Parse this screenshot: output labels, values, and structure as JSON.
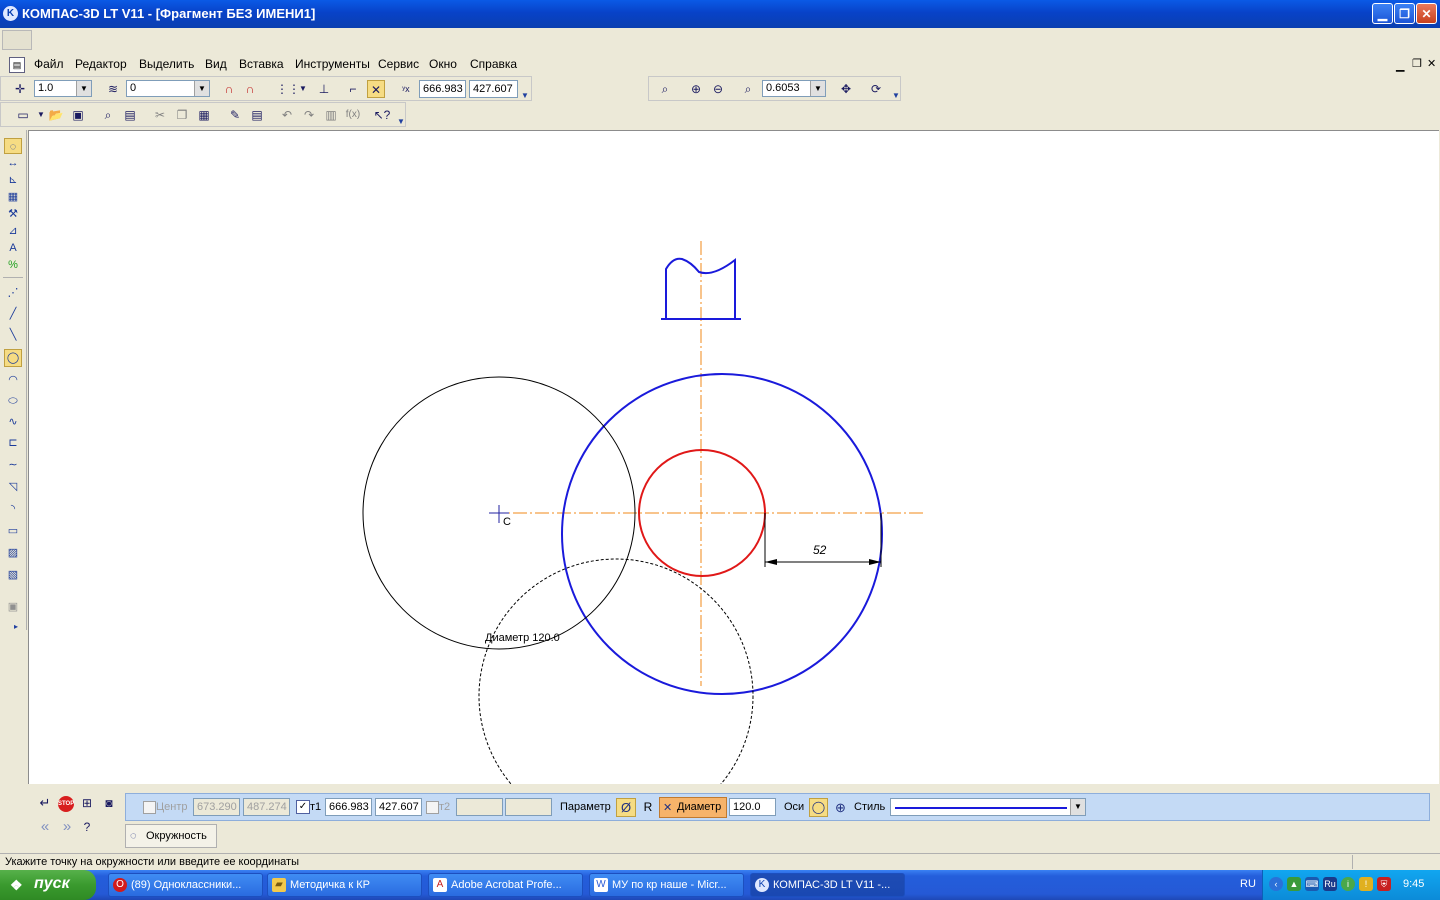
{
  "window": {
    "title": "КОМПАС-3D LT V11 - [Фрагмент БЕЗ ИМЕНИ1]",
    "app_icon": "kompas-icon",
    "controls": [
      "minimize-icon",
      "restore-icon",
      "close-icon"
    ]
  },
  "menu": {
    "items": [
      "Файл",
      "Редактор",
      "Выделить",
      "Вид",
      "Вставка",
      "Инструменты",
      "Сервис",
      "Окно",
      "Справка"
    ]
  },
  "toolbar_current": {
    "step_value": "1.0",
    "layer_value": "0",
    "coord_x": "666.983",
    "coord_y": "427.607"
  },
  "toolbar_view": {
    "zoom_value": "0.6053"
  },
  "canvas": {
    "dimension_text": "52",
    "phantom_label": "Диаметр 120.0",
    "cursor_label": "C",
    "colors": {
      "blue": "#1a1adb",
      "red": "#e01818",
      "axis": "#f08a1a",
      "black": "#000000"
    }
  },
  "property_panel": {
    "center_label": "Центр",
    "center_x": "673.290",
    "center_y": "487.274",
    "t1_label": "т1",
    "t1_x": "666.983",
    "t1_y": "427.607",
    "t2_label": "т2",
    "t2_x": "",
    "t2_y": "",
    "param_label": "Параметр",
    "diameter_symbol": "Ø",
    "radius_symbol": "R",
    "diameter_label": "Диаметр",
    "diameter_value": "120.0",
    "axes_label": "Оси",
    "style_label": "Стиль",
    "tab_label": "Окружность"
  },
  "status": {
    "text": "Укажите точку на окружности или введите ее координаты"
  },
  "taskbar": {
    "start_label": "пуск",
    "tasks": [
      {
        "label": "(89) Одноклассники...",
        "icon": "opera-icon",
        "color": "#d21b1b"
      },
      {
        "label": "Методичка к КР",
        "icon": "folder-icon",
        "color": "#f2c94c"
      },
      {
        "label": "Adobe Acrobat Profe...",
        "icon": "acrobat-icon",
        "color": "#c8201e"
      },
      {
        "label": "МУ по кр наше - Micr...",
        "icon": "word-icon",
        "color": "#2a5bd7"
      },
      {
        "label": "КОМПАС-3D LT V11 -...",
        "icon": "kompas-icon",
        "color": "#dfe8ff"
      }
    ],
    "lang": "RU",
    "clock": "9:45"
  }
}
